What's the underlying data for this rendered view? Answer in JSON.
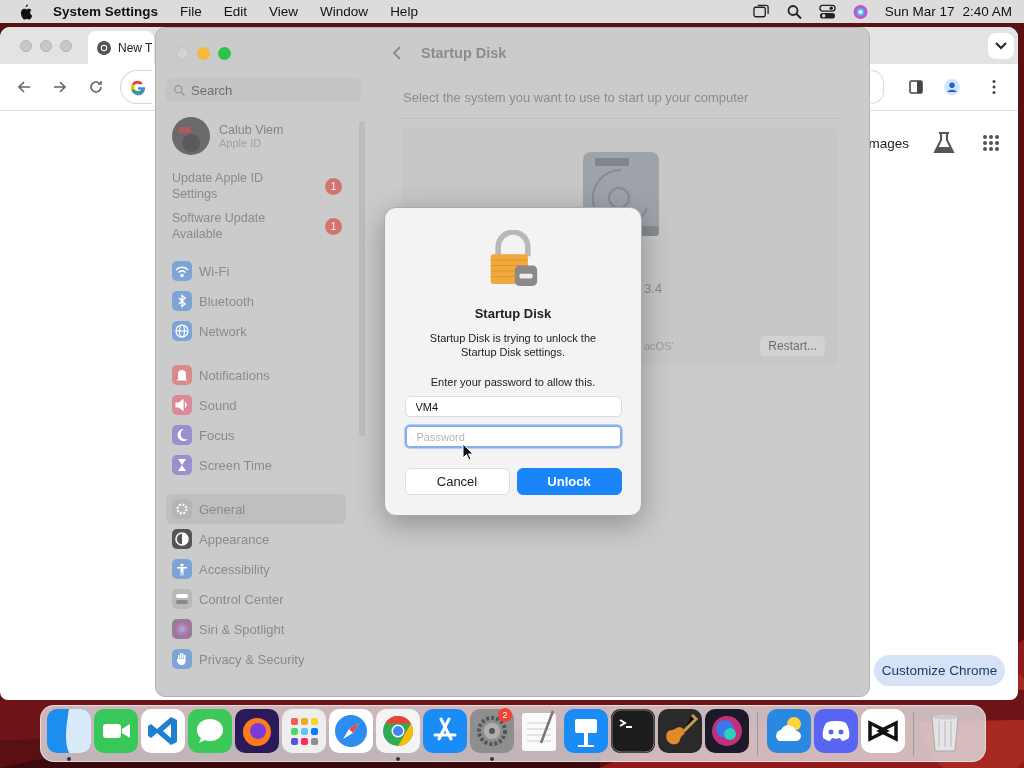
{
  "menu_bar": {
    "app": "System Settings",
    "items": [
      "File",
      "Edit",
      "View",
      "Window",
      "Help"
    ],
    "date": "Sun Mar 17",
    "time": "2:40 AM"
  },
  "browser": {
    "tab_title": "New T",
    "images_link": "mages",
    "customize_button": "Customize Chrome"
  },
  "settings": {
    "search_placeholder": "Search",
    "title": "Startup Disk",
    "instruction": "Select the system you want to use to start up your computer",
    "account": {
      "name": "Calub Viem",
      "subtitle": "Apple ID"
    },
    "notices": [
      {
        "label": "Update Apple ID Settings",
        "badge": "1"
      },
      {
        "label": "Software Update Available",
        "badge": "1"
      }
    ],
    "groups": [
      {
        "items": [
          {
            "label": "Wi-Fi",
            "color": "#7ea3d6",
            "selected": false
          },
          {
            "label": "Bluetooth",
            "color": "#7ea3d6",
            "selected": false
          },
          {
            "label": "Network",
            "color": "#7ea3d6",
            "selected": false
          }
        ]
      },
      {
        "items": [
          {
            "label": "Notifications",
            "color": "#d98a8a",
            "selected": false
          },
          {
            "label": "Sound",
            "color": "#d98a96",
            "selected": false
          },
          {
            "label": "Focus",
            "color": "#9a8fcf",
            "selected": false
          },
          {
            "label": "Screen Time",
            "color": "#9a8fcf",
            "selected": false
          }
        ]
      },
      {
        "items": [
          {
            "label": "General",
            "color": "#b5b5b5",
            "selected": true
          },
          {
            "label": "Appearance",
            "color": "#555555",
            "selected": false
          },
          {
            "label": "Accessibility",
            "color": "#7ea3d6",
            "selected": false
          },
          {
            "label": "Control Center",
            "color": "#b8b8b8",
            "selected": false
          },
          {
            "label": "Siri & Spotlight",
            "color": "#9a7a98",
            "selected": false
          },
          {
            "label": "Privacy & Security",
            "color": "#7ea3d6",
            "selected": false
          }
        ]
      }
    ],
    "disk_version": "3.4",
    "disk_label": "acOS’",
    "restart_button": "Restart..."
  },
  "dialog": {
    "title": "Startup Disk",
    "message": "Startup Disk is trying to unlock the Startup Disk settings.",
    "prompt": "Enter your password to allow this.",
    "username": "VM4",
    "password": {
      "placeholder": "Password",
      "focused": true
    },
    "buttons": [
      {
        "label": "Cancel",
        "kind": "secondary"
      },
      {
        "label": "Unlock",
        "kind": "default"
      }
    ]
  },
  "dock": {
    "items": [
      {
        "kind": "app",
        "running": true
      },
      {
        "kind": "app",
        "running": false
      },
      {
        "kind": "app",
        "running": false
      },
      {
        "kind": "app",
        "running": false
      },
      {
        "kind": "app",
        "running": false
      },
      {
        "kind": "app",
        "running": false
      },
      {
        "kind": "app",
        "running": false
      },
      {
        "kind": "app",
        "running": true
      },
      {
        "kind": "app",
        "running": false
      },
      {
        "kind": "app",
        "running": true,
        "badge": "2"
      },
      {
        "kind": "app",
        "running": false
      },
      {
        "kind": "app",
        "running": false
      },
      {
        "kind": "app",
        "running": false
      },
      {
        "kind": "app",
        "running": false
      },
      {
        "kind": "app",
        "running": false
      },
      {
        "kind": "separator"
      },
      {
        "kind": "app",
        "running": false
      },
      {
        "kind": "app",
        "running": false
      },
      {
        "kind": "app",
        "running": false
      },
      {
        "kind": "separator"
      },
      {
        "kind": "app",
        "running": false
      }
    ]
  }
}
